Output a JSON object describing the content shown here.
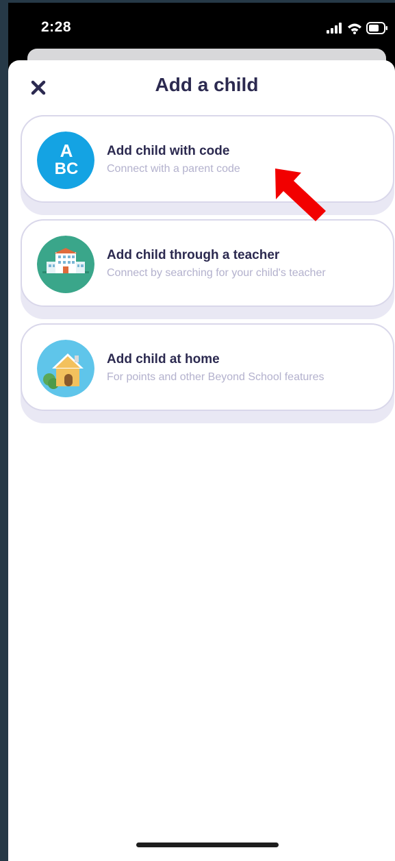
{
  "status_bar": {
    "time": "2:28",
    "icons": [
      "signal-icon",
      "wifi-icon",
      "battery-icon"
    ]
  },
  "header": {
    "title": "Add a child",
    "close_icon": "close-icon"
  },
  "options": [
    {
      "label": "Add child with code",
      "sublabel": "Connect with a parent code",
      "icon": "abc-icon",
      "icon_text_top": "A",
      "icon_text_bottom": "BC",
      "icon_color": "#14a3e3"
    },
    {
      "label": "Add child through a teacher",
      "sublabel": "Connect by searching for your child's teacher",
      "icon": "school-building-icon",
      "icon_color": "#3aa68a"
    },
    {
      "label": "Add child at home",
      "sublabel": "For points and other Beyond School features",
      "icon": "house-icon",
      "icon_color": "#5fc5ea"
    }
  ],
  "annotation": {
    "icon": "red-arrow-icon",
    "color": "#f20000"
  },
  "colors": {
    "title": "#2c2a50",
    "sublabel": "#b3b1cd",
    "card_border": "#d9d7ea",
    "background": "#263947"
  }
}
